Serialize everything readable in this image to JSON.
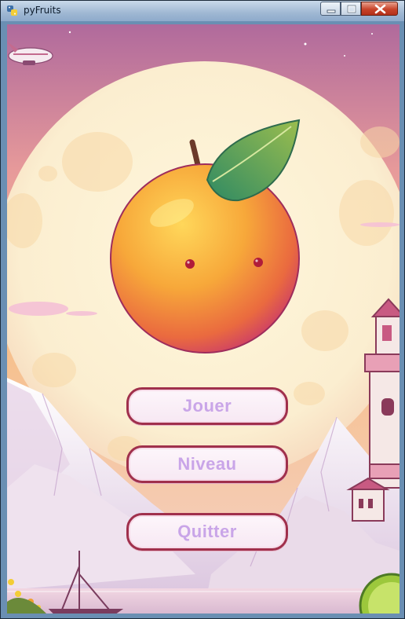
{
  "window": {
    "title": "pyFruits",
    "icon": "python-logo-icon",
    "controls": [
      "minimize-icon",
      "maximize-icon",
      "close-icon"
    ]
  },
  "menu": {
    "play_label": "Jouer",
    "level_label": "Niveau",
    "quit_label": "Quitter"
  },
  "colors": {
    "button_text": "#c9a5e8",
    "button_border": "#a0304c",
    "sky_top": "#b86a9a",
    "moon": "#fbeed0"
  }
}
